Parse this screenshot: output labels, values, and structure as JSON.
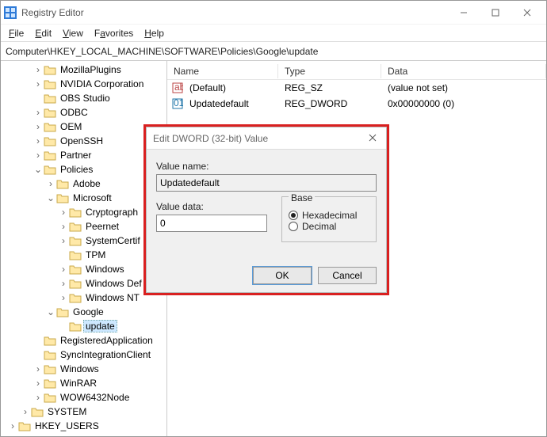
{
  "window": {
    "title": "Registry Editor"
  },
  "menu": {
    "file": "File",
    "edit": "Edit",
    "view": "View",
    "favorites": "Favorites",
    "help": "Help"
  },
  "path": "Computer\\HKEY_LOCAL_MACHINE\\SOFTWARE\\Policies\\Google\\update",
  "tree": {
    "mozillaplugins": "MozillaPlugins",
    "nvidia": "NVIDIA Corporation",
    "obs": "OBS Studio",
    "odbc": "ODBC",
    "oem": "OEM",
    "openssh": "OpenSSH",
    "partner": "Partner",
    "policies": "Policies",
    "adobe": "Adobe",
    "microsoft": "Microsoft",
    "crypto": "Cryptograph",
    "peernet": "Peernet",
    "syscert": "SystemCertif",
    "tpm": "TPM",
    "windows_ms": "Windows",
    "windowsdef": "Windows Def",
    "windowsnt": "Windows NT",
    "google": "Google",
    "update": "update",
    "regapp": "RegisteredApplication",
    "syncint": "SyncIntegrationClient",
    "windows_sw": "Windows",
    "winrar": "WinRAR",
    "wow64": "WOW6432Node",
    "system": "SYSTEM",
    "hkeyusers": "HKEY_USERS"
  },
  "list": {
    "head_name": "Name",
    "head_type": "Type",
    "head_data": "Data",
    "rows": [
      {
        "name": "(Default)",
        "type": "REG_SZ",
        "data": "(value not set)"
      },
      {
        "name": "Updatedefault",
        "type": "REG_DWORD",
        "data": "0x00000000 (0)"
      }
    ]
  },
  "dialog": {
    "title": "Edit DWORD (32-bit) Value",
    "value_name_label": "Value name:",
    "value_name": "Updatedefault",
    "value_data_label": "Value data:",
    "value_data": "0",
    "base_label": "Base",
    "hex": "Hexadecimal",
    "dec": "Decimal",
    "ok": "OK",
    "cancel": "Cancel"
  }
}
